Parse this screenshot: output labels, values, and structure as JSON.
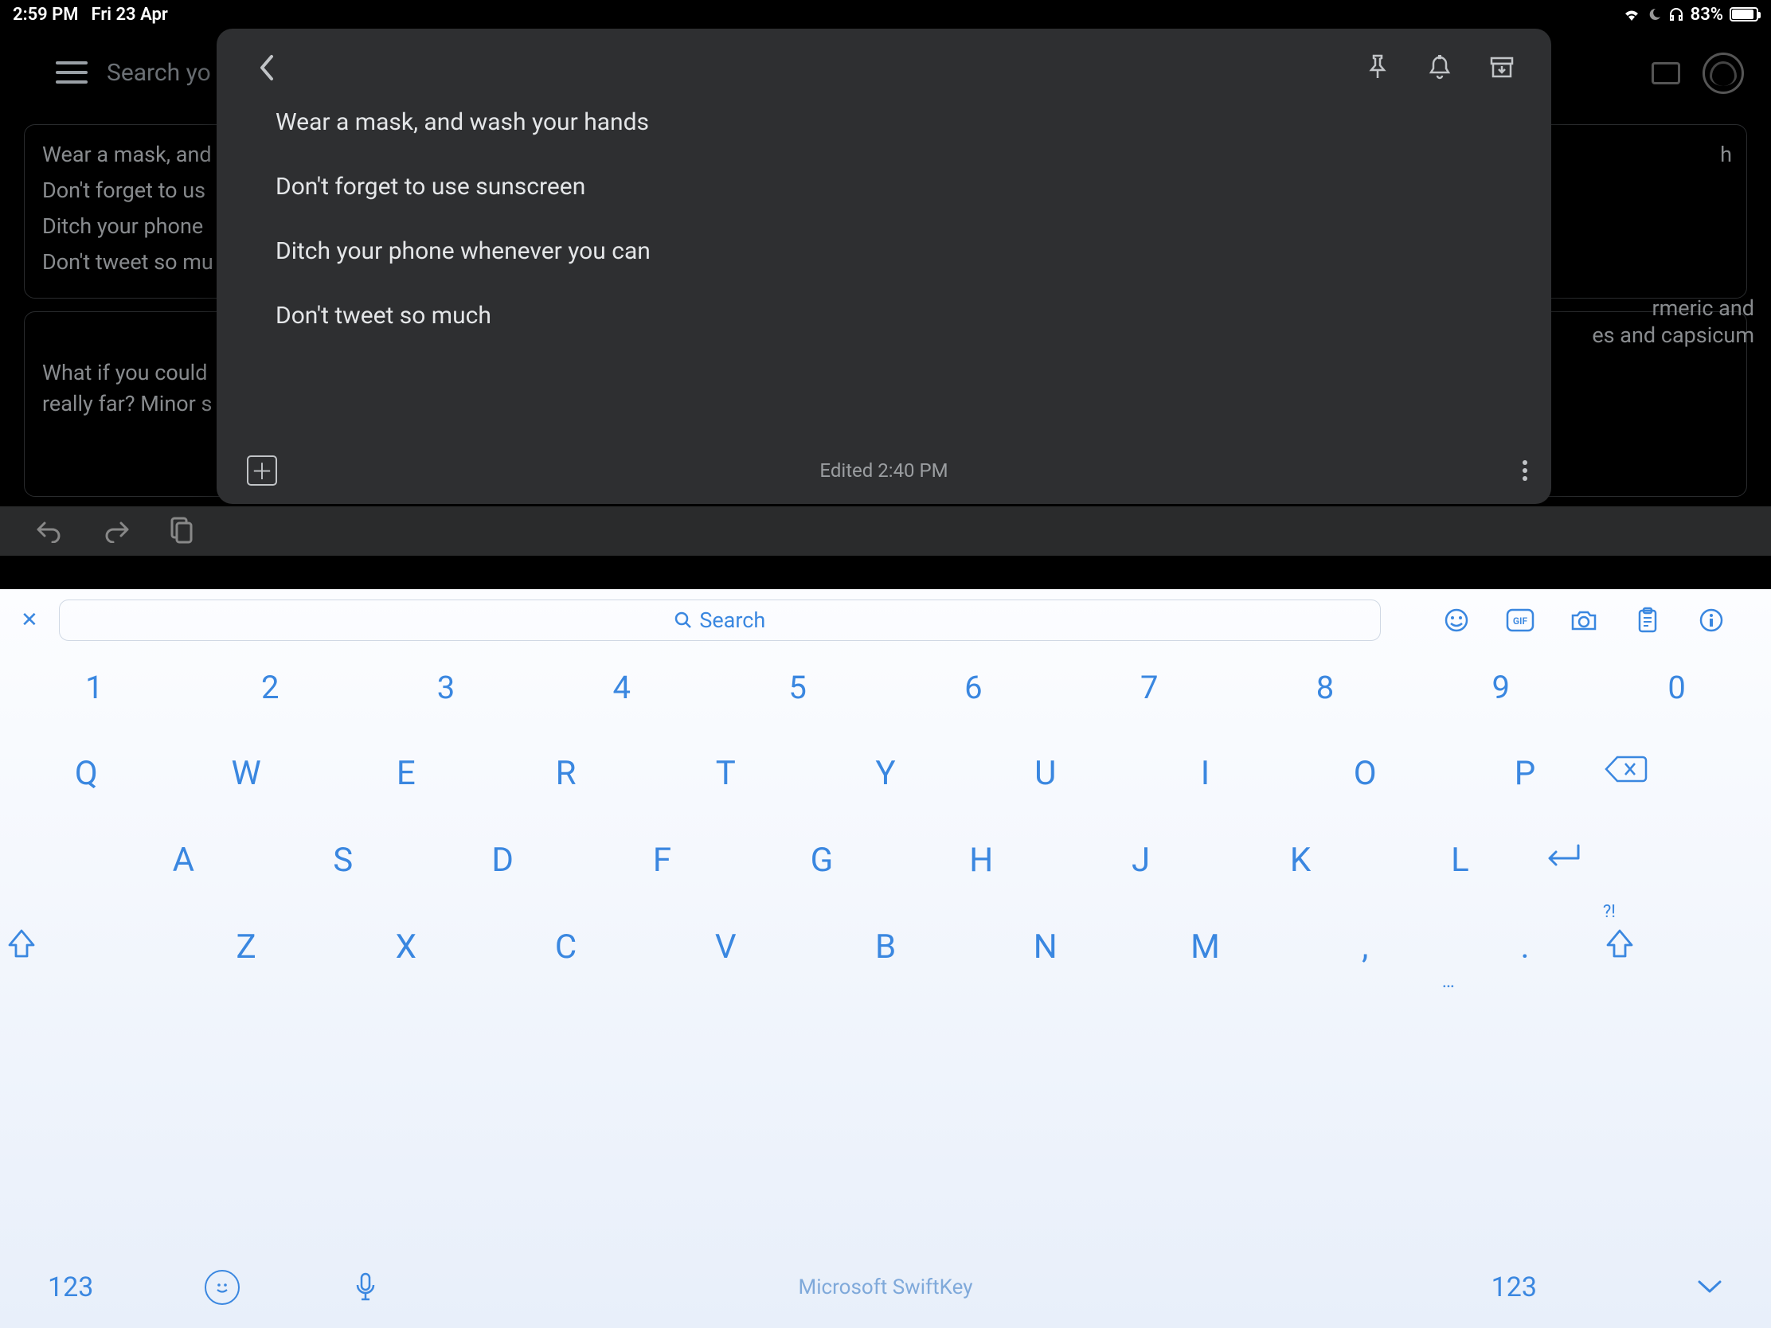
{
  "status": {
    "time": "2:59 PM",
    "date": "Fri 23 Apr",
    "battery": "83%"
  },
  "bg": {
    "search_placeholder": "Search yo",
    "card1": {
      "l1": "Wear a mask, and",
      "l2": "Don't forget to us",
      "l3": "Ditch your phone",
      "l4": "Don't tweet so mu"
    },
    "card2": "What if you could\nreally far? Minor s",
    "rfrag1": "h",
    "rfrag2": "rmeric and",
    "rfrag3": "es and capsicum"
  },
  "note": {
    "l1": "Wear a mask, and wash your hands",
    "l2": "Don't forget to use sunscreen",
    "l3": "Ditch your phone whenever you can",
    "l4": "Don't tweet so much",
    "edited": "Edited 2:40 PM"
  },
  "kb": {
    "search_placeholder": "Search",
    "brand": "Microsoft SwiftKey",
    "label_123": "123",
    "row_num": [
      "1",
      "2",
      "3",
      "4",
      "5",
      "6",
      "7",
      "8",
      "9",
      "0"
    ],
    "row_q": [
      "Q",
      "W",
      "E",
      "R",
      "T",
      "Y",
      "U",
      "I",
      "O",
      "P"
    ],
    "row_a": [
      "A",
      "S",
      "D",
      "F",
      "G",
      "H",
      "J",
      "K",
      "L"
    ],
    "row_z": [
      "Z",
      "X",
      "C",
      "V",
      "B",
      "N",
      "M",
      ",",
      "."
    ],
    "punct_sub": "?!",
    "ellipsis_sub": "…"
  }
}
